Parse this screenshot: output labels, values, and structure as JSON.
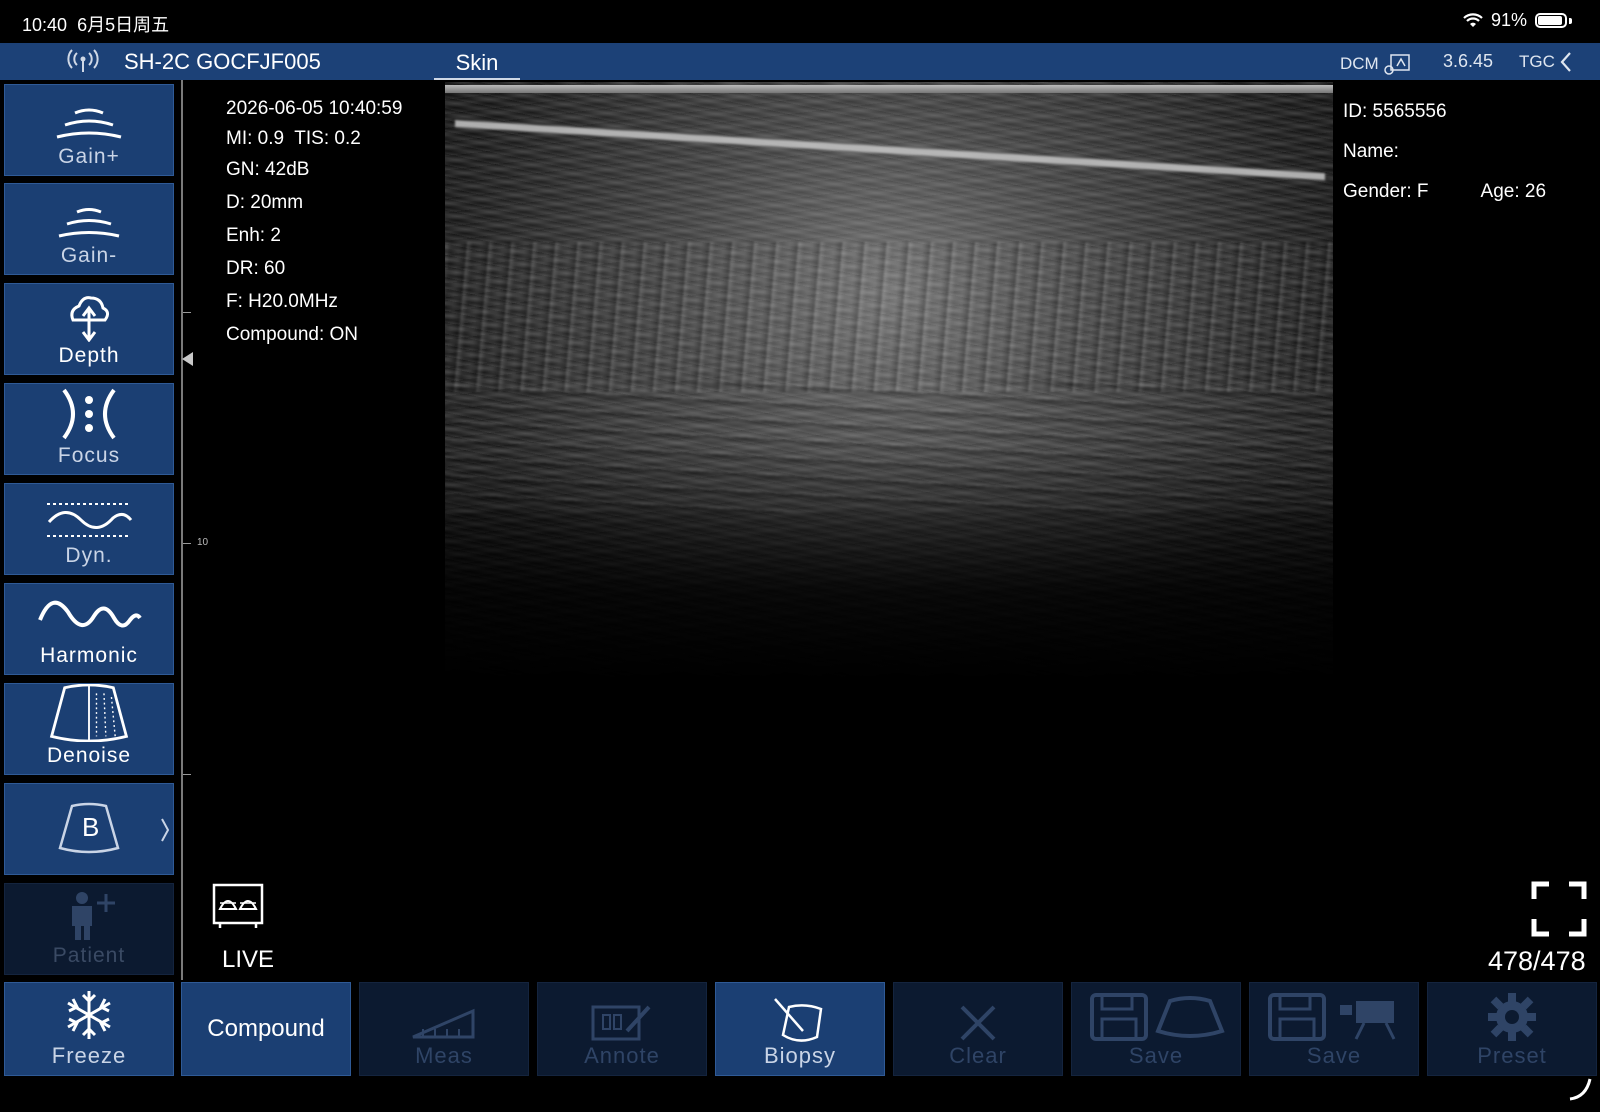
{
  "status_bar": {
    "time": "10:40",
    "date": "6月5日周五",
    "battery": "91%",
    "wifi_icon": "wifi-icon"
  },
  "header": {
    "device_name": "SH-2C GOCFJF005",
    "preset": "Skin",
    "dcm_label": "DCM",
    "version": "3.6.45",
    "tgc_label": "TGC"
  },
  "left_panel": {
    "gain_plus": "Gain+",
    "gain_minus": "Gain-",
    "depth": "Depth",
    "focus": "Focus",
    "dyn": "Dyn.",
    "harmonic": "Harmonic",
    "denoise": "Denoise",
    "mode": "B",
    "patient": "Patient"
  },
  "scan_info": {
    "datetime": "2026-06-05 10:40:59",
    "mi_tis": "MI: 0.9  TIS: 0.2",
    "gain": "GN: 42dB",
    "depth": "D: 20mm",
    "enhancement": "Enh: 2",
    "dynamic_range": "DR: 60",
    "frequency": "F: H20.0MHz",
    "compound": "Compound: ON"
  },
  "patient_info": {
    "id": "ID: 5565556",
    "name": "Name:",
    "gender": "Gender: F",
    "age": "Age: 26"
  },
  "ruler": {
    "depth_mark": "10"
  },
  "status": {
    "live": "LIVE",
    "frames": "478/478"
  },
  "bottom_bar": {
    "freeze": "Freeze",
    "compound": "Compound",
    "meas": "Meas",
    "annote": "Annote",
    "biopsy": "Biopsy",
    "clear": "Clear",
    "save_image": "Save",
    "save_cine": "Save",
    "preset": "Preset"
  },
  "colors": {
    "panel_blue": "#1b3f73",
    "header_blue": "#1c4177",
    "disabled": "#0c1a30"
  }
}
